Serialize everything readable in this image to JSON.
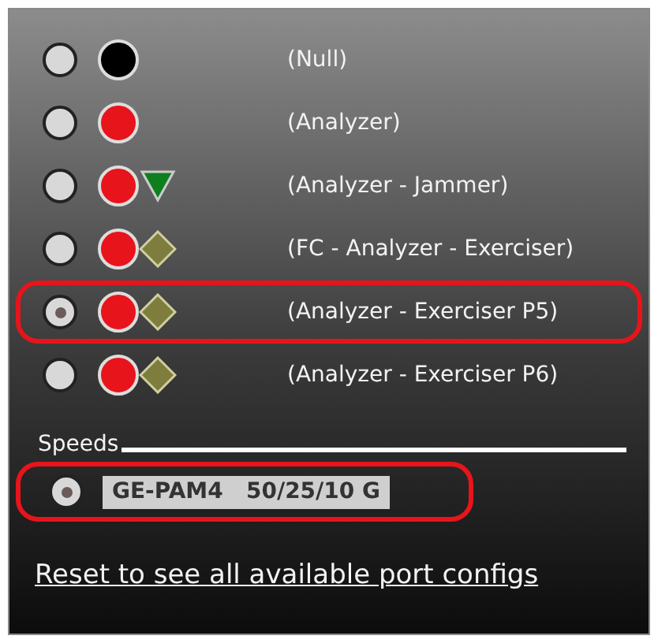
{
  "configs": [
    {
      "label": "(Null)",
      "selected": false,
      "color": "#000000",
      "kind": "none"
    },
    {
      "label": "(Analyzer)",
      "selected": false,
      "color": "#e8141b",
      "kind": "none"
    },
    {
      "label": "(Analyzer - Jammer)",
      "selected": false,
      "color": "#e8141b",
      "kind": "triangle"
    },
    {
      "label": "(FC - Analyzer - Exerciser)",
      "selected": false,
      "color": "#e8141b",
      "kind": "diamond"
    },
    {
      "label": "(Analyzer - Exerciser P5)",
      "selected": true,
      "color": "#e8141b",
      "kind": "diamond"
    },
    {
      "label": "(Analyzer - Exerciser P6)",
      "selected": false,
      "color": "#e8141b",
      "kind": "diamond"
    }
  ],
  "speeds": {
    "title": "Speeds",
    "items": [
      {
        "label": "GE-PAM4   50/25/10 G",
        "selected": true
      }
    ]
  },
  "reset_link": "Reset to see all available port configs"
}
